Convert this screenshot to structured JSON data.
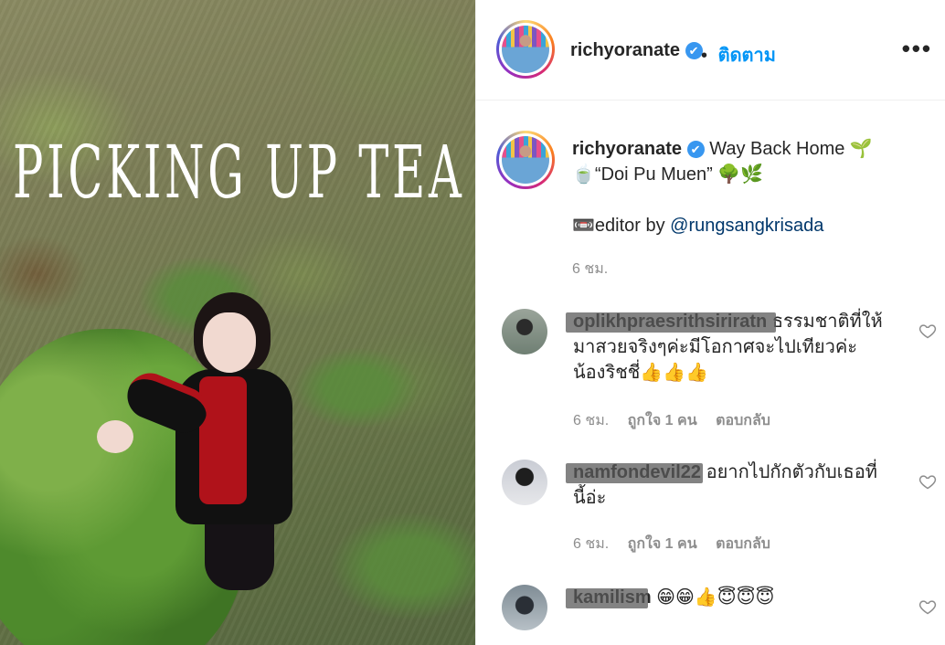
{
  "media": {
    "video_text": "PICKING UP TEA"
  },
  "header": {
    "username": "richyoranate",
    "verified_mark": "✔",
    "dot": "•",
    "follow_label": "ติดตาม",
    "more_label": "•••"
  },
  "caption": {
    "username": "richyoranate",
    "line1": "Way Back Home 🌱",
    "line2": "🍵“Doi Pu Muen” 🌳🌿",
    "line3_prefix": "📼editor by ",
    "mention": "@rungsangkrisada",
    "time": "6 ชม."
  },
  "comments": [
    {
      "username": "oplikhpraesrithsiriratn",
      "text": "ธรรมชาติที่ให้มาสวยจริงๆค่ะมีโอกาศจะไปเทียวค่ะน้องริชชี่👍👍👍",
      "time": "6 ชม.",
      "likes": "ถูกใจ 1 คน",
      "reply": "ตอบกลับ"
    },
    {
      "username": "namfondevil22",
      "text": "อยากไปกักตัวกับเธอที่นี้อ่ะ",
      "time": "6 ชม.",
      "likes": "ถูกใจ 1 คน",
      "reply": "ตอบกลับ"
    },
    {
      "username": "kamilism",
      "text": "😁😁👍😇😇😇"
    }
  ],
  "colors": {
    "link_blue": "#0095f6",
    "mention_blue": "#00376b",
    "muted_gray": "#8e8e8e",
    "text_dark": "#262626",
    "verified_blue": "#3897f0"
  },
  "icons": {
    "verified": "verified-badge-icon",
    "more": "more-options-icon",
    "like": "heart-outline-icon"
  }
}
